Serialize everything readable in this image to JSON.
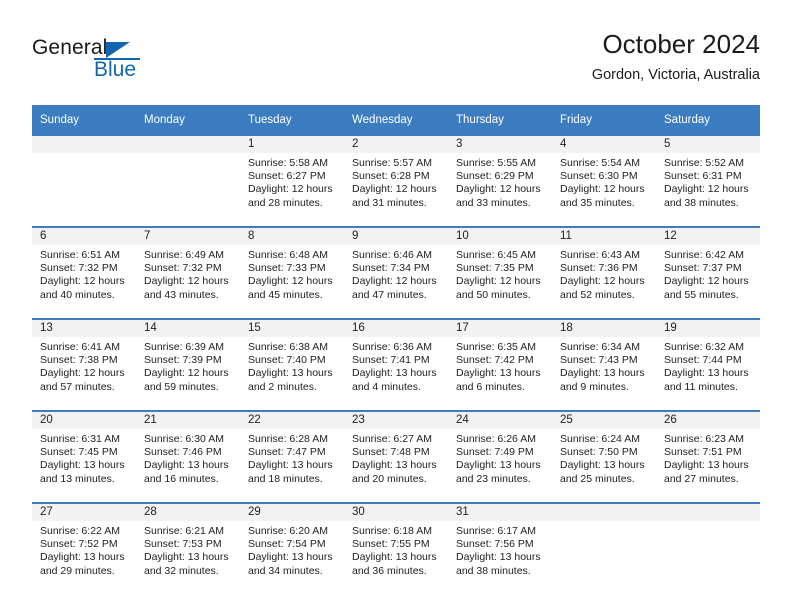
{
  "brand": {
    "name_part1": "General",
    "name_part2": "Blue",
    "logo_icon": "triangle-icon",
    "accent_color": "#1266b0"
  },
  "header": {
    "title": "October 2024",
    "subtitle": "Gordon, Victoria, Australia"
  },
  "calendar": {
    "header_color": "#3b7dc0",
    "daynum_band_color": "#f2f2f2",
    "weekday_headers": [
      "Sunday",
      "Monday",
      "Tuesday",
      "Wednesday",
      "Thursday",
      "Friday",
      "Saturday"
    ],
    "weeks": [
      [
        {
          "day": "",
          "sunrise": "",
          "sunset": "",
          "daylight": "",
          "empty": true
        },
        {
          "day": "",
          "sunrise": "",
          "sunset": "",
          "daylight": "",
          "empty": true
        },
        {
          "day": "1",
          "sunrise": "Sunrise: 5:58 AM",
          "sunset": "Sunset: 6:27 PM",
          "daylight": "Daylight: 12 hours and 28 minutes."
        },
        {
          "day": "2",
          "sunrise": "Sunrise: 5:57 AM",
          "sunset": "Sunset: 6:28 PM",
          "daylight": "Daylight: 12 hours and 31 minutes."
        },
        {
          "day": "3",
          "sunrise": "Sunrise: 5:55 AM",
          "sunset": "Sunset: 6:29 PM",
          "daylight": "Daylight: 12 hours and 33 minutes."
        },
        {
          "day": "4",
          "sunrise": "Sunrise: 5:54 AM",
          "sunset": "Sunset: 6:30 PM",
          "daylight": "Daylight: 12 hours and 35 minutes."
        },
        {
          "day": "5",
          "sunrise": "Sunrise: 5:52 AM",
          "sunset": "Sunset: 6:31 PM",
          "daylight": "Daylight: 12 hours and 38 minutes."
        }
      ],
      [
        {
          "day": "6",
          "sunrise": "Sunrise: 6:51 AM",
          "sunset": "Sunset: 7:32 PM",
          "daylight": "Daylight: 12 hours and 40 minutes."
        },
        {
          "day": "7",
          "sunrise": "Sunrise: 6:49 AM",
          "sunset": "Sunset: 7:32 PM",
          "daylight": "Daylight: 12 hours and 43 minutes."
        },
        {
          "day": "8",
          "sunrise": "Sunrise: 6:48 AM",
          "sunset": "Sunset: 7:33 PM",
          "daylight": "Daylight: 12 hours and 45 minutes."
        },
        {
          "day": "9",
          "sunrise": "Sunrise: 6:46 AM",
          "sunset": "Sunset: 7:34 PM",
          "daylight": "Daylight: 12 hours and 47 minutes."
        },
        {
          "day": "10",
          "sunrise": "Sunrise: 6:45 AM",
          "sunset": "Sunset: 7:35 PM",
          "daylight": "Daylight: 12 hours and 50 minutes."
        },
        {
          "day": "11",
          "sunrise": "Sunrise: 6:43 AM",
          "sunset": "Sunset: 7:36 PM",
          "daylight": "Daylight: 12 hours and 52 minutes."
        },
        {
          "day": "12",
          "sunrise": "Sunrise: 6:42 AM",
          "sunset": "Sunset: 7:37 PM",
          "daylight": "Daylight: 12 hours and 55 minutes."
        }
      ],
      [
        {
          "day": "13",
          "sunrise": "Sunrise: 6:41 AM",
          "sunset": "Sunset: 7:38 PM",
          "daylight": "Daylight: 12 hours and 57 minutes."
        },
        {
          "day": "14",
          "sunrise": "Sunrise: 6:39 AM",
          "sunset": "Sunset: 7:39 PM",
          "daylight": "Daylight: 12 hours and 59 minutes."
        },
        {
          "day": "15",
          "sunrise": "Sunrise: 6:38 AM",
          "sunset": "Sunset: 7:40 PM",
          "daylight": "Daylight: 13 hours and 2 minutes."
        },
        {
          "day": "16",
          "sunrise": "Sunrise: 6:36 AM",
          "sunset": "Sunset: 7:41 PM",
          "daylight": "Daylight: 13 hours and 4 minutes."
        },
        {
          "day": "17",
          "sunrise": "Sunrise: 6:35 AM",
          "sunset": "Sunset: 7:42 PM",
          "daylight": "Daylight: 13 hours and 6 minutes."
        },
        {
          "day": "18",
          "sunrise": "Sunrise: 6:34 AM",
          "sunset": "Sunset: 7:43 PM",
          "daylight": "Daylight: 13 hours and 9 minutes."
        },
        {
          "day": "19",
          "sunrise": "Sunrise: 6:32 AM",
          "sunset": "Sunset: 7:44 PM",
          "daylight": "Daylight: 13 hours and 11 minutes."
        }
      ],
      [
        {
          "day": "20",
          "sunrise": "Sunrise: 6:31 AM",
          "sunset": "Sunset: 7:45 PM",
          "daylight": "Daylight: 13 hours and 13 minutes."
        },
        {
          "day": "21",
          "sunrise": "Sunrise: 6:30 AM",
          "sunset": "Sunset: 7:46 PM",
          "daylight": "Daylight: 13 hours and 16 minutes."
        },
        {
          "day": "22",
          "sunrise": "Sunrise: 6:28 AM",
          "sunset": "Sunset: 7:47 PM",
          "daylight": "Daylight: 13 hours and 18 minutes."
        },
        {
          "day": "23",
          "sunrise": "Sunrise: 6:27 AM",
          "sunset": "Sunset: 7:48 PM",
          "daylight": "Daylight: 13 hours and 20 minutes."
        },
        {
          "day": "24",
          "sunrise": "Sunrise: 6:26 AM",
          "sunset": "Sunset: 7:49 PM",
          "daylight": "Daylight: 13 hours and 23 minutes."
        },
        {
          "day": "25",
          "sunrise": "Sunrise: 6:24 AM",
          "sunset": "Sunset: 7:50 PM",
          "daylight": "Daylight: 13 hours and 25 minutes."
        },
        {
          "day": "26",
          "sunrise": "Sunrise: 6:23 AM",
          "sunset": "Sunset: 7:51 PM",
          "daylight": "Daylight: 13 hours and 27 minutes."
        }
      ],
      [
        {
          "day": "27",
          "sunrise": "Sunrise: 6:22 AM",
          "sunset": "Sunset: 7:52 PM",
          "daylight": "Daylight: 13 hours and 29 minutes."
        },
        {
          "day": "28",
          "sunrise": "Sunrise: 6:21 AM",
          "sunset": "Sunset: 7:53 PM",
          "daylight": "Daylight: 13 hours and 32 minutes."
        },
        {
          "day": "29",
          "sunrise": "Sunrise: 6:20 AM",
          "sunset": "Sunset: 7:54 PM",
          "daylight": "Daylight: 13 hours and 34 minutes."
        },
        {
          "day": "30",
          "sunrise": "Sunrise: 6:18 AM",
          "sunset": "Sunset: 7:55 PM",
          "daylight": "Daylight: 13 hours and 36 minutes."
        },
        {
          "day": "31",
          "sunrise": "Sunrise: 6:17 AM",
          "sunset": "Sunset: 7:56 PM",
          "daylight": "Daylight: 13 hours and 38 minutes."
        },
        {
          "day": "",
          "sunrise": "",
          "sunset": "",
          "daylight": "",
          "empty": true
        },
        {
          "day": "",
          "sunrise": "",
          "sunset": "",
          "daylight": "",
          "empty": true
        }
      ]
    ]
  }
}
